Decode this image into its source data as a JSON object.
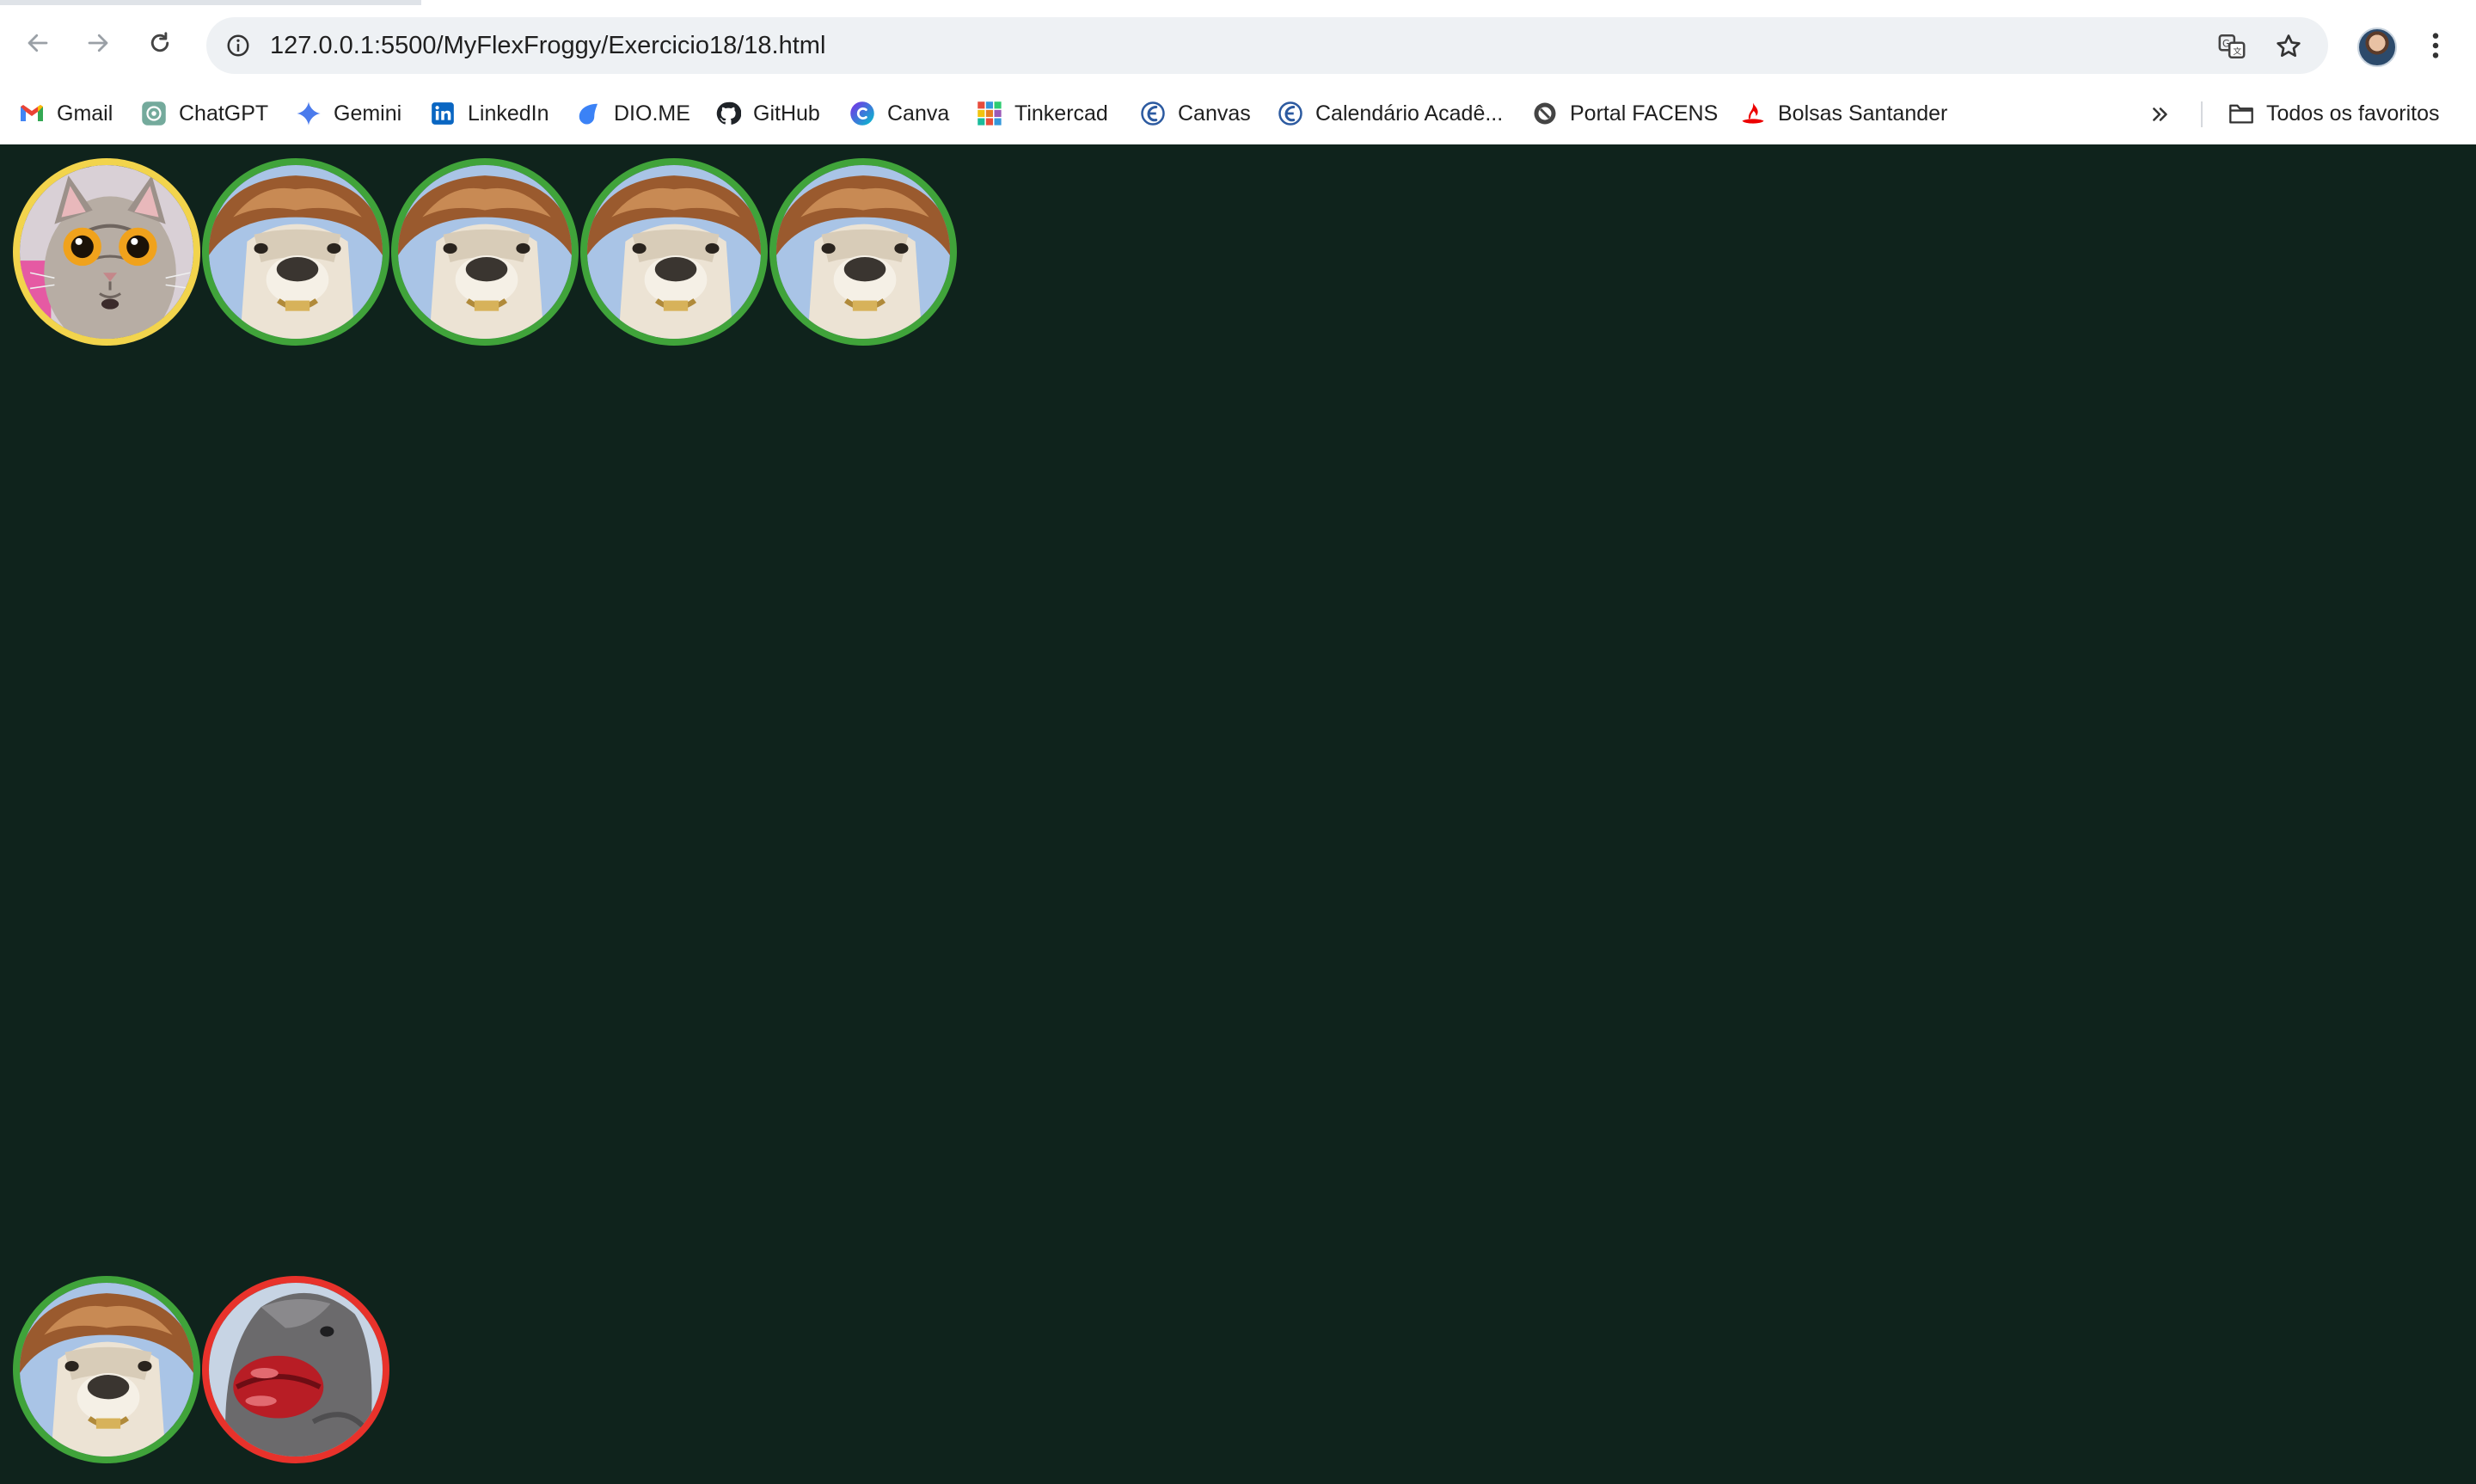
{
  "browser": {
    "url": "127.0.0.1:5500/MyFlexFroggy/Exercicio18/18.html",
    "bookmarks": [
      {
        "label": "Gmail",
        "icon": "gmail-icon",
        "color": "#ea4335"
      },
      {
        "label": "ChatGPT",
        "icon": "chatgpt-icon",
        "color": "#74aa9c"
      },
      {
        "label": "Gemini",
        "icon": "gemini-icon",
        "color": "#4b7bec"
      },
      {
        "label": "LinkedIn",
        "icon": "linkedin-icon",
        "color": "#0a66c2"
      },
      {
        "label": "DIO.ME",
        "icon": "dio-icon",
        "color": "#3b82f6"
      },
      {
        "label": "GitHub",
        "icon": "github-icon",
        "color": "#1f2328"
      },
      {
        "label": "Canva",
        "icon": "canva-icon",
        "color": "#1d7fe0"
      },
      {
        "label": "Tinkercad",
        "icon": "tinkercad-icon",
        "color": "#e74c3c"
      },
      {
        "label": "Canvas",
        "icon": "canvas-icon",
        "color": "#2c5aa0"
      },
      {
        "label": "Calendário Acadê...",
        "icon": "calendar-icon",
        "color": "#2c5aa0"
      },
      {
        "label": "Portal FACENS",
        "icon": "facens-icon",
        "color": "#444444"
      },
      {
        "label": "Bolsas Santander",
        "icon": "santander-icon",
        "color": "#ec0000"
      }
    ],
    "all_bookmarks_label": "Todos os favoritos"
  },
  "game": {
    "background": "#0f231c",
    "top_row": [
      {
        "kind": "cat",
        "border": "yellow"
      },
      {
        "kind": "alpaca",
        "border": "green"
      },
      {
        "kind": "alpaca",
        "border": "green"
      },
      {
        "kind": "alpaca",
        "border": "green"
      },
      {
        "kind": "alpaca",
        "border": "green"
      }
    ],
    "bottom_row": [
      {
        "kind": "alpaca",
        "border": "green"
      },
      {
        "kind": "lips",
        "border": "red"
      }
    ]
  }
}
